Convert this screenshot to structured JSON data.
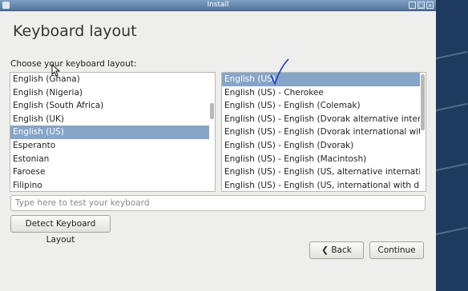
{
  "window": {
    "title": "Install"
  },
  "page": {
    "heading": "Keyboard layout",
    "choose_label": "Choose your keyboard layout:"
  },
  "layouts": [
    "English (Ghana)",
    "English (Nigeria)",
    "English (South Africa)",
    "English (UK)",
    "English (US)",
    "Esperanto",
    "Estonian",
    "Faroese",
    "Filipino"
  ],
  "variants": [
    "English (US)",
    "English (US) - Cherokee",
    "English (US) - English (Colemak)",
    "English (US) - English (Dvorak alternative international no dead keys)",
    "English (US) - English (Dvorak international with dead keys)",
    "English (US) - English (Dvorak)",
    "English (US) - English (Macintosh)",
    "English (US) - English (US, alternative international)",
    "English (US) - English (US, international with dead keys)"
  ],
  "test": {
    "placeholder": "Type here to test your keyboard"
  },
  "buttons": {
    "detect": "Detect Keyboard Layout",
    "back": "Back",
    "continue": "Continue"
  },
  "colors": {
    "selection": "#86a5c8",
    "titlebar": "#6a8ab0"
  }
}
